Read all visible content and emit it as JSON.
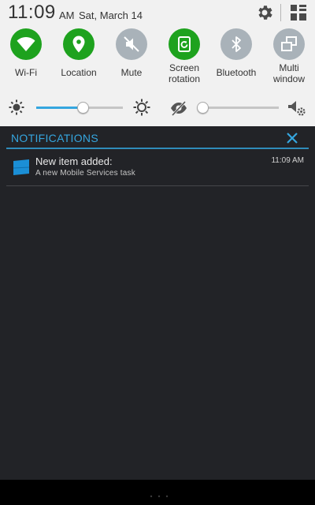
{
  "status_bar": {
    "time": "11:09",
    "ampm": "AM",
    "date": "Sat, March 14",
    "settings_icon": "gear-icon",
    "grid_icon": "grid-edit-icon"
  },
  "quick_toggles": [
    {
      "label": "Wi-Fi",
      "icon": "wifi-icon",
      "state": "on"
    },
    {
      "label": "Location",
      "icon": "location-pin-icon",
      "state": "on"
    },
    {
      "label": "Mute",
      "icon": "mute-icon",
      "state": "off"
    },
    {
      "label": "Screen\nrotation",
      "icon": "screen-rotation-icon",
      "state": "on"
    },
    {
      "label": "Bluetooth",
      "icon": "bluetooth-icon",
      "state": "off"
    },
    {
      "label": "Multi\nwindow",
      "icon": "multi-window-icon",
      "state": "off"
    }
  ],
  "brightness": {
    "level": 0.54,
    "auto_icon": "auto-brightness-icon"
  },
  "volume": {
    "level": 0.0,
    "icon": "volume-settings-icon"
  },
  "notifications": {
    "header": "NOTIFICATIONS",
    "clear_icon": "close-icon",
    "items": [
      {
        "title": "New item added:",
        "text": "A new Mobile Services  task",
        "time": "11:09 AM",
        "icon": "mobile-services-flag-icon"
      }
    ]
  },
  "colors": {
    "accent": "#35a6df",
    "toggle_on": "#1ea21e",
    "toggle_off": "#a9b2b9",
    "shade_bg": "#222327",
    "panel_bg": "#f1f1f1"
  }
}
